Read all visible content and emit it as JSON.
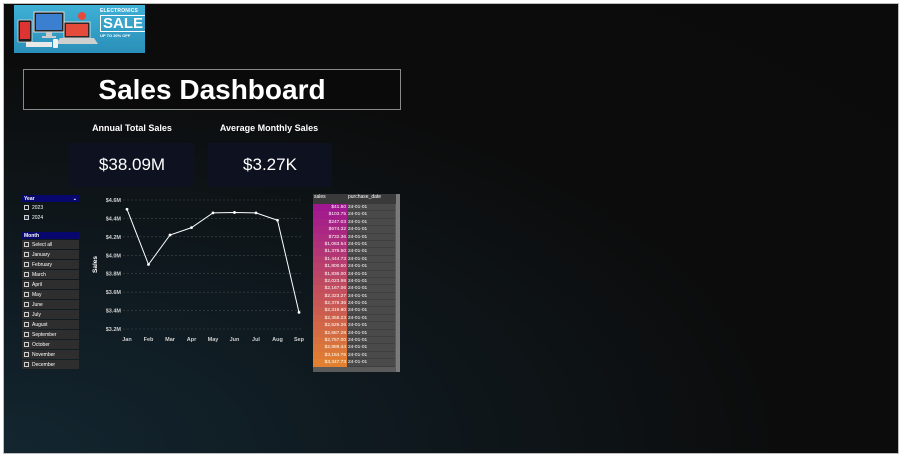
{
  "banner": {
    "line1": "ELECTRONICS",
    "line2": "SALE",
    "line3": "UP TO 20% OFF"
  },
  "title": "Sales Dashboard",
  "kpis": [
    {
      "label": "Annual Total Sales",
      "value": "$38.09M"
    },
    {
      "label": "Average Monthly Sales",
      "value": "$3.27K"
    }
  ],
  "year_slicer": {
    "title": "Year",
    "items": [
      "2023",
      "2024"
    ]
  },
  "month_slicer": {
    "title": "Month",
    "items": [
      "Select all",
      "January",
      "February",
      "March",
      "April",
      "May",
      "June",
      "July",
      "August",
      "September",
      "October",
      "November",
      "December"
    ]
  },
  "chart_data": {
    "type": "line",
    "categories": [
      "Jan",
      "Feb",
      "Mar",
      "Apr",
      "May",
      "Jun",
      "Jul",
      "Aug",
      "Sep"
    ],
    "values": [
      4.5,
      3.9,
      4.22,
      4.3,
      4.46,
      4.465,
      4.46,
      4.38,
      3.38
    ],
    "ylabel": "Sales",
    "ylim": [
      3.2,
      4.6
    ],
    "yticks": [
      "$3.2M",
      "$3.4M",
      "$3.6M",
      "$3.8M",
      "$4.0M",
      "$4.2M",
      "$4.4M",
      "$4.6M"
    ],
    "grid": true,
    "line_color": "#ffffff"
  },
  "table": {
    "columns": [
      "sales",
      "purchase_date"
    ],
    "rows": [
      [
        "$41.50",
        "24-01-01"
      ],
      [
        "$103.75",
        "24-01-01"
      ],
      [
        "$247.03",
        "24-01-01"
      ],
      [
        "$674.32",
        "24-01-01"
      ],
      [
        "$732.36",
        "24-01-01"
      ],
      [
        "$1,083.54",
        "24-01-01"
      ],
      [
        "$1,378.50",
        "24-01-01"
      ],
      [
        "$1,444.73",
        "24-01-01"
      ],
      [
        "$1,800.50",
        "24-01-01"
      ],
      [
        "$1,836.00",
        "24-01-01"
      ],
      [
        "$2,023.98",
        "24-01-01"
      ],
      [
        "$2,167.06",
        "24-01-01"
      ],
      [
        "$2,323.27",
        "24-01-01"
      ],
      [
        "$2,379.36",
        "24-01-01"
      ],
      [
        "$2,319.80",
        "24-01-01"
      ],
      [
        "$2,358.23",
        "24-01-01"
      ],
      [
        "$2,526.26",
        "24-01-01"
      ],
      [
        "$2,687.28",
        "24-01-01"
      ],
      [
        "$2,757.00",
        "24-01-01"
      ],
      [
        "$2,889.44",
        "24-01-01"
      ],
      [
        "$3,184.76",
        "24-01-01"
      ],
      [
        "$3,347.73",
        "24-01-01"
      ]
    ],
    "gradient_start": "#a01890",
    "gradient_end": "#e08030"
  }
}
